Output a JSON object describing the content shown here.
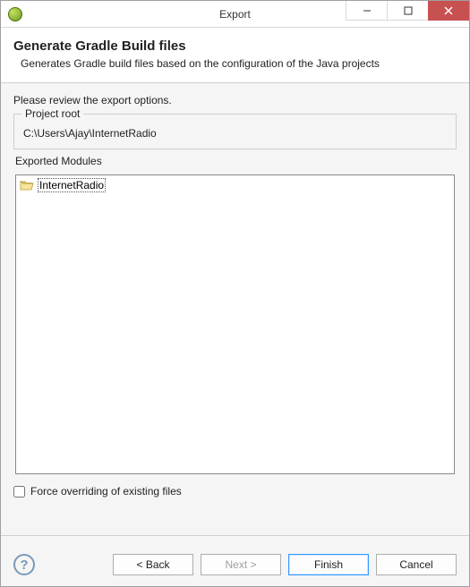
{
  "window": {
    "title": "Export"
  },
  "header": {
    "title": "Generate Gradle Build files",
    "subtitle": "Generates Gradle build files based on the configuration of the Java projects"
  },
  "content": {
    "prompt": "Please review the export options.",
    "project_root_label": "Project root",
    "project_root_path": "C:\\Users\\Ajay\\InternetRadio",
    "exported_modules_label": "Exported Modules",
    "modules": [
      {
        "name": "InternetRadio"
      }
    ],
    "force_override_label": "Force overriding of existing files",
    "force_override_checked": false
  },
  "buttons": {
    "back": "< Back",
    "next": "Next >",
    "finish": "Finish",
    "cancel": "Cancel"
  }
}
